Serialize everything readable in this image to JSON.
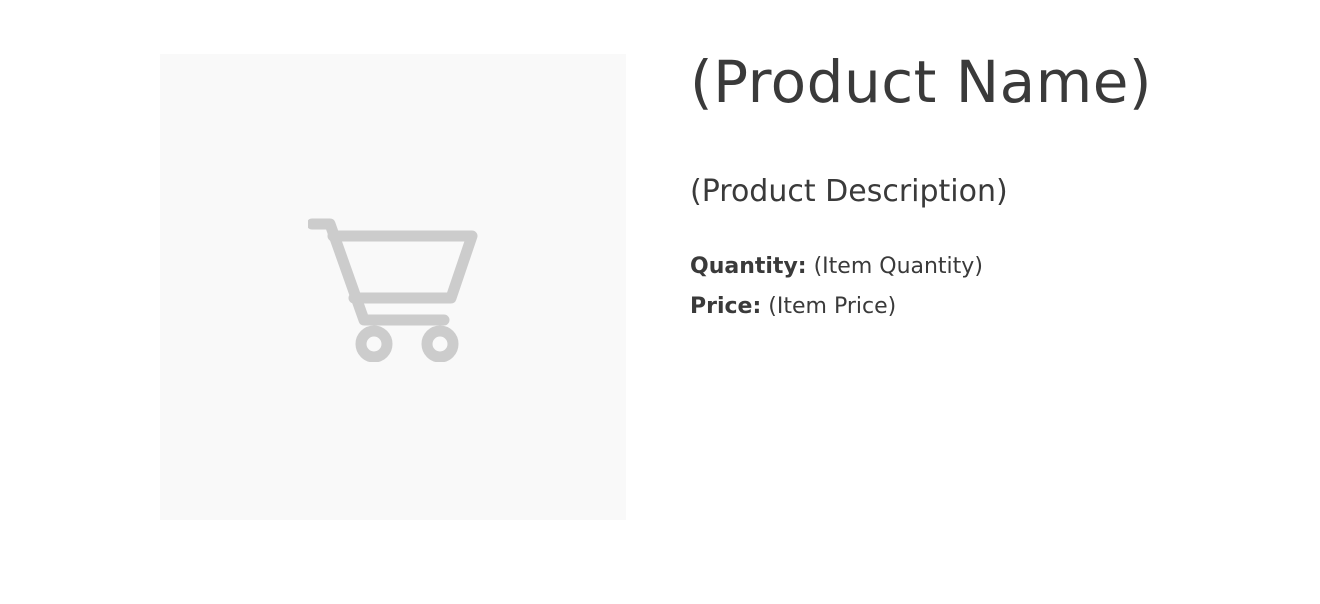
{
  "product": {
    "image_icon": "shopping-cart-icon",
    "name": "(Product Name)",
    "description": "(Product Description)",
    "quantity_label": "Quantity:",
    "quantity_value": "(Item Quantity)",
    "price_label": "Price:",
    "price_value": "(Item Price)"
  },
  "colors": {
    "text": "#3a3a3a",
    "image_background": "#f9f9f9",
    "icon": "#cccccc"
  }
}
